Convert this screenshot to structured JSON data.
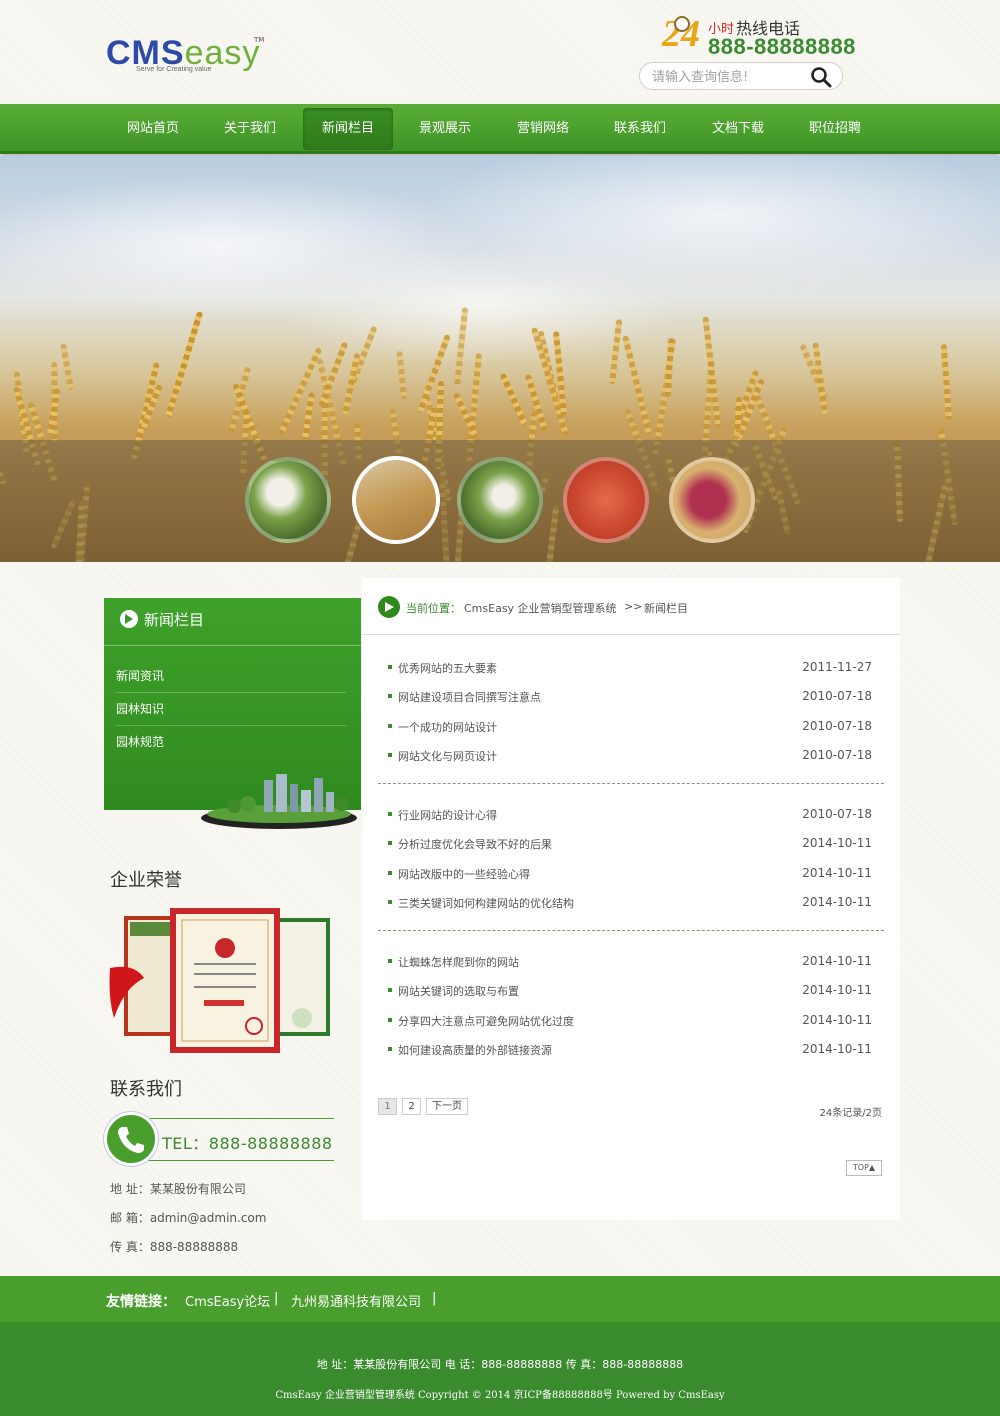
{
  "header": {
    "logo": {
      "cms": "CMS",
      "easy": "easy",
      "tm": "TM",
      "slogan": "Serve for Creating value"
    },
    "hotline": {
      "number_24": "24",
      "small": "小时",
      "label": "热线电话",
      "phone": "888-88888888"
    },
    "search": {
      "placeholder": "请输入查询信息!",
      "icon": "search-icon"
    }
  },
  "nav": {
    "items": [
      {
        "label": "网站首页"
      },
      {
        "label": "关于我们"
      },
      {
        "label": "新闻栏目",
        "active": true
      },
      {
        "label": "景观展示"
      },
      {
        "label": "营销网络"
      },
      {
        "label": "联系我们"
      },
      {
        "label": "文档下载"
      },
      {
        "label": "职位招聘"
      }
    ]
  },
  "banner": {
    "active_thumb": 2
  },
  "sidebar": {
    "menu_title": "新闻栏目",
    "menu_items": [
      {
        "label": "新闻资讯"
      },
      {
        "label": "园林知识"
      },
      {
        "label": "园林规范"
      }
    ],
    "honor_title": "企业荣誉",
    "contact_title": "联系我们",
    "tel": "TEL：888-88888888",
    "address": "地 址：某某股份有限公司",
    "email": "邮 箱：admin@admin.com",
    "fax": "传 真：888-88888888"
  },
  "breadcrumb": {
    "label": "当前位置：",
    "path": "CmsEasy 企业营销型管理系统",
    "sep": ">>",
    "current": "新闻栏目"
  },
  "news": {
    "groups": [
      [
        {
          "title": "优秀网站的五大要素",
          "date": "2011-11-27"
        },
        {
          "title": "网站建设项目合同撰写注意点",
          "date": "2010-07-18"
        },
        {
          "title": "一个成功的网站设计",
          "date": "2010-07-18"
        },
        {
          "title": "网站文化与网页设计",
          "date": "2010-07-18"
        }
      ],
      [
        {
          "title": "行业网站的设计心得",
          "date": "2010-07-18"
        },
        {
          "title": "分析过度优化会导致不好的后果",
          "date": "2014-10-11"
        },
        {
          "title": "网站改版中的一些经验心得",
          "date": "2014-10-11"
        },
        {
          "title": "三类关键词如何构建网站的优化结构",
          "date": "2014-10-11"
        }
      ],
      [
        {
          "title": "让蜘蛛怎样爬到你的网站",
          "date": "2014-10-11"
        },
        {
          "title": "网站关键词的选取与布置",
          "date": "2014-10-11"
        },
        {
          "title": "分享四大注意点可避免网站优化过度",
          "date": "2014-10-11"
        },
        {
          "title": "如何建设高质量的外部链接资源",
          "date": "2014-10-11"
        }
      ]
    ]
  },
  "pager": {
    "page1": "1",
    "page2": "2",
    "next": "下一页",
    "records": "24条记录/2页"
  },
  "top_button": "TOP",
  "friend_links": {
    "label": "友情链接：",
    "items": [
      "CmsEasy论坛",
      "九州易通科技有限公司"
    ],
    "sep": "|"
  },
  "footer": {
    "line1": "地 址：某某股份有限公司    电 话：888-88888888    传 真：888-88888888",
    "line2": "CmsEasy 企业营销型管理系统 Copyright © 2014 京ICP备88888888号 Powered by CmsEasy"
  },
  "colors": {
    "brand_green": "#4a9e2e",
    "dark_green": "#3a8a2e",
    "logo_blue": "#2e4aa8"
  }
}
